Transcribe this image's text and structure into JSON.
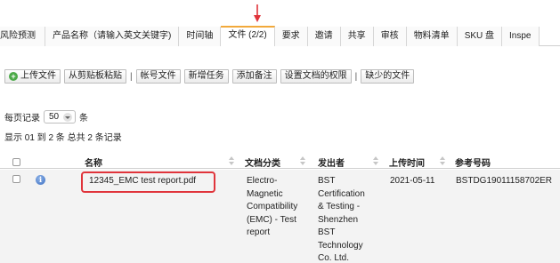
{
  "tabs": [
    {
      "label": "风险预测",
      "active": false
    },
    {
      "label": "产品名称（请输入英文关键字)",
      "active": false
    },
    {
      "label": "时间轴",
      "active": false
    },
    {
      "label": "文件 (2/2)",
      "active": true
    },
    {
      "label": "要求",
      "active": false
    },
    {
      "label": "邀请",
      "active": false
    },
    {
      "label": "共享",
      "active": false
    },
    {
      "label": "审核",
      "active": false
    },
    {
      "label": "物料清单",
      "active": false
    },
    {
      "label": "SKU 盘",
      "active": false
    },
    {
      "label": "Inspe",
      "active": false
    }
  ],
  "toolbar": {
    "upload": "上传文件",
    "paste": "从剪贴板粘贴",
    "separator": "|",
    "account_file": "帐号文件",
    "new_task": "新增任务",
    "add_note": "添加备注",
    "permissions": "设置文档的权限",
    "missing": "缺少的文件"
  },
  "pagination": {
    "per_page_label": "每页记录",
    "per_page_value": "50",
    "per_page_unit": "条",
    "count_text": "显示 01 到 2 条 总共 2 条记录"
  },
  "table": {
    "headers": {
      "name": "名称",
      "category": "文档分类",
      "issuer": "发出者",
      "upload_time": "上传时间",
      "ref_no": "参考号码"
    },
    "rows": [
      {
        "name": "12345_EMC test report.pdf",
        "category_lines": [
          "Electro-",
          "Magnetic",
          "Compatibility",
          "(EMC) - Test",
          "report"
        ],
        "issuer_lines": [
          "BST",
          "Certification",
          "& Testing -",
          "Shenzhen",
          "BST",
          "Technology",
          "Co. Ltd."
        ],
        "upload_time": "2021-05-11",
        "ref_no": "BSTDG19011158702ER"
      }
    ]
  },
  "colors": {
    "active_tab_accent": "#f2a93b",
    "highlight": "#e0343b",
    "upload_icon": "#4caa48",
    "info_icon": "#3c6fc2"
  }
}
